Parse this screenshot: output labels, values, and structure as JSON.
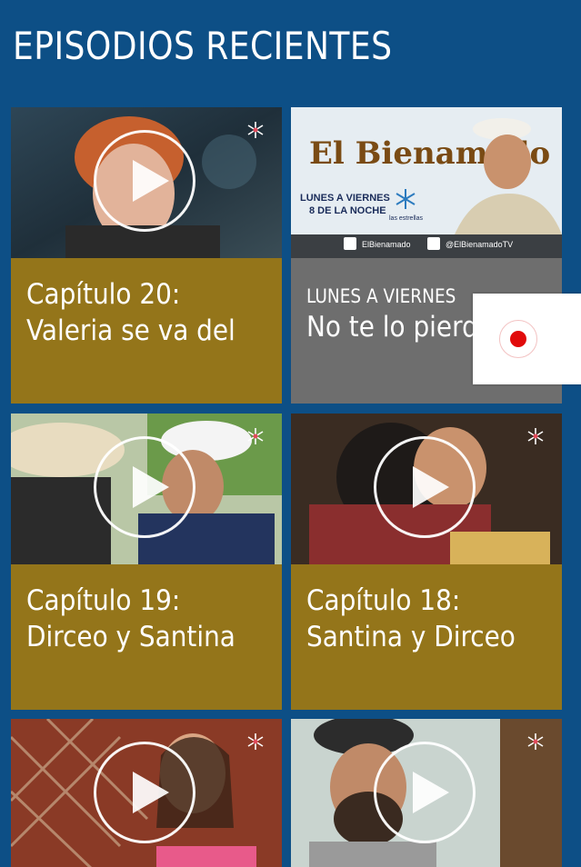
{
  "page": {
    "title": "EPISODIOS RECIENTES"
  },
  "episodes": [
    {
      "caption": "Capítulo 20: Valeria se va del",
      "line1": "Capítulo 20:",
      "line2": "Valeria se va del"
    },
    {
      "promo_small": "LUNES A VIERNES",
      "promo_big": "No te lo pierdas",
      "banner": {
        "logo_text": "El Bienamado",
        "schedule_line1": "LUNES A VIERNES",
        "schedule_line2": "8 DE LA NOCHE",
        "channel": "las estrellas",
        "facebook": "ElBienamado",
        "twitter": "@ElBienamadoTV"
      }
    },
    {
      "line1": "Capítulo 19:",
      "line2": "Dirceo y Santina"
    },
    {
      "line1": "Capítulo 18:",
      "line2": "Santina y Dirceo"
    },
    {
      "line1": "",
      "line2": ""
    },
    {
      "line1": "",
      "line2": ""
    }
  ],
  "colors": {
    "background": "#0d4f86",
    "caption": "#94751a",
    "promo_caption": "#6e6e6e",
    "record": "#e10a0a"
  },
  "icons": [
    "play-icon",
    "record-icon",
    "channel-logo-icon"
  ]
}
